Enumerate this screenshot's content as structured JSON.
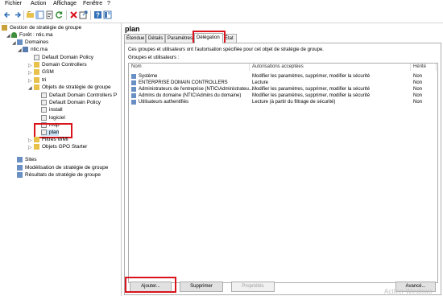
{
  "menu": [
    "Fichier",
    "Action",
    "Affichage",
    "Fenêtre",
    "?"
  ],
  "toolbar_icons": [
    "back-arrow-icon",
    "forward-arrow-icon",
    "up-folder-icon",
    "show-hide-tree-icon",
    "properties-icon",
    "refresh-icon",
    "delete-icon",
    "export-icon",
    "help-icon",
    "mmc-icon"
  ],
  "tree": {
    "root": "Gestion de stratégie de groupe",
    "forest": "Forêt : ntic.ma",
    "domains": "Domaines",
    "domain": "ntic.ma",
    "items": [
      "Default Domain Policy",
      "Domain Controllers",
      "GSM",
      "tri",
      "Objets de stratégie de groupe"
    ],
    "gpos": [
      "Default Domain Controllers P",
      "Default Domain Policy",
      "install",
      "logiciel",
      "mdp",
      "plan"
    ],
    "after": [
      "Filtres WMI",
      "Objets GPO Starter"
    ],
    "sites": "Sites",
    "modeling": "Modélisation de stratégie de groupe",
    "results": "Résultats de stratégie de groupe"
  },
  "right": {
    "title": "plan",
    "tabs": [
      "Étendue",
      "Détails",
      "Paramètres",
      "Délégation",
      "État"
    ],
    "active_tab": "Délégation",
    "description": "Ces groupes et utilisateurs ont l'autorisation spécifiée pour cet objet de stratégie de groupe.",
    "groups_label": "Groupes et utilisateurs :",
    "columns": [
      "Nom",
      "Autorisations acceptées",
      "Hérité"
    ],
    "rows": [
      {
        "name": "Système",
        "perm": "Modifier les paramètres, supprimer, modifier la sécurité",
        "inh": "Non"
      },
      {
        "name": "ENTERPRISE DOMAIN CONTROLLERS",
        "perm": "Lecture",
        "inh": "Non"
      },
      {
        "name": "Administrateurs de l'entreprise (NTIC\\Administrateu...",
        "perm": "Modifier les paramètres, supprimer, modifier la sécurité",
        "inh": "Non"
      },
      {
        "name": "Admins du domaine (NTIC\\Admins du domaine)",
        "perm": "Modifier les paramètres, supprimer, modifier la sécurité",
        "inh": "Non"
      },
      {
        "name": "Utilisateurs authentifiés",
        "perm": "Lecture (à partir du filtrage de sécurité)",
        "inh": "Non"
      }
    ],
    "buttons": {
      "add": "Ajouter...",
      "remove": "Supprimer",
      "props": "Propriétés",
      "advanced": "Avancé..."
    }
  },
  "watermark": "Activer Windows"
}
